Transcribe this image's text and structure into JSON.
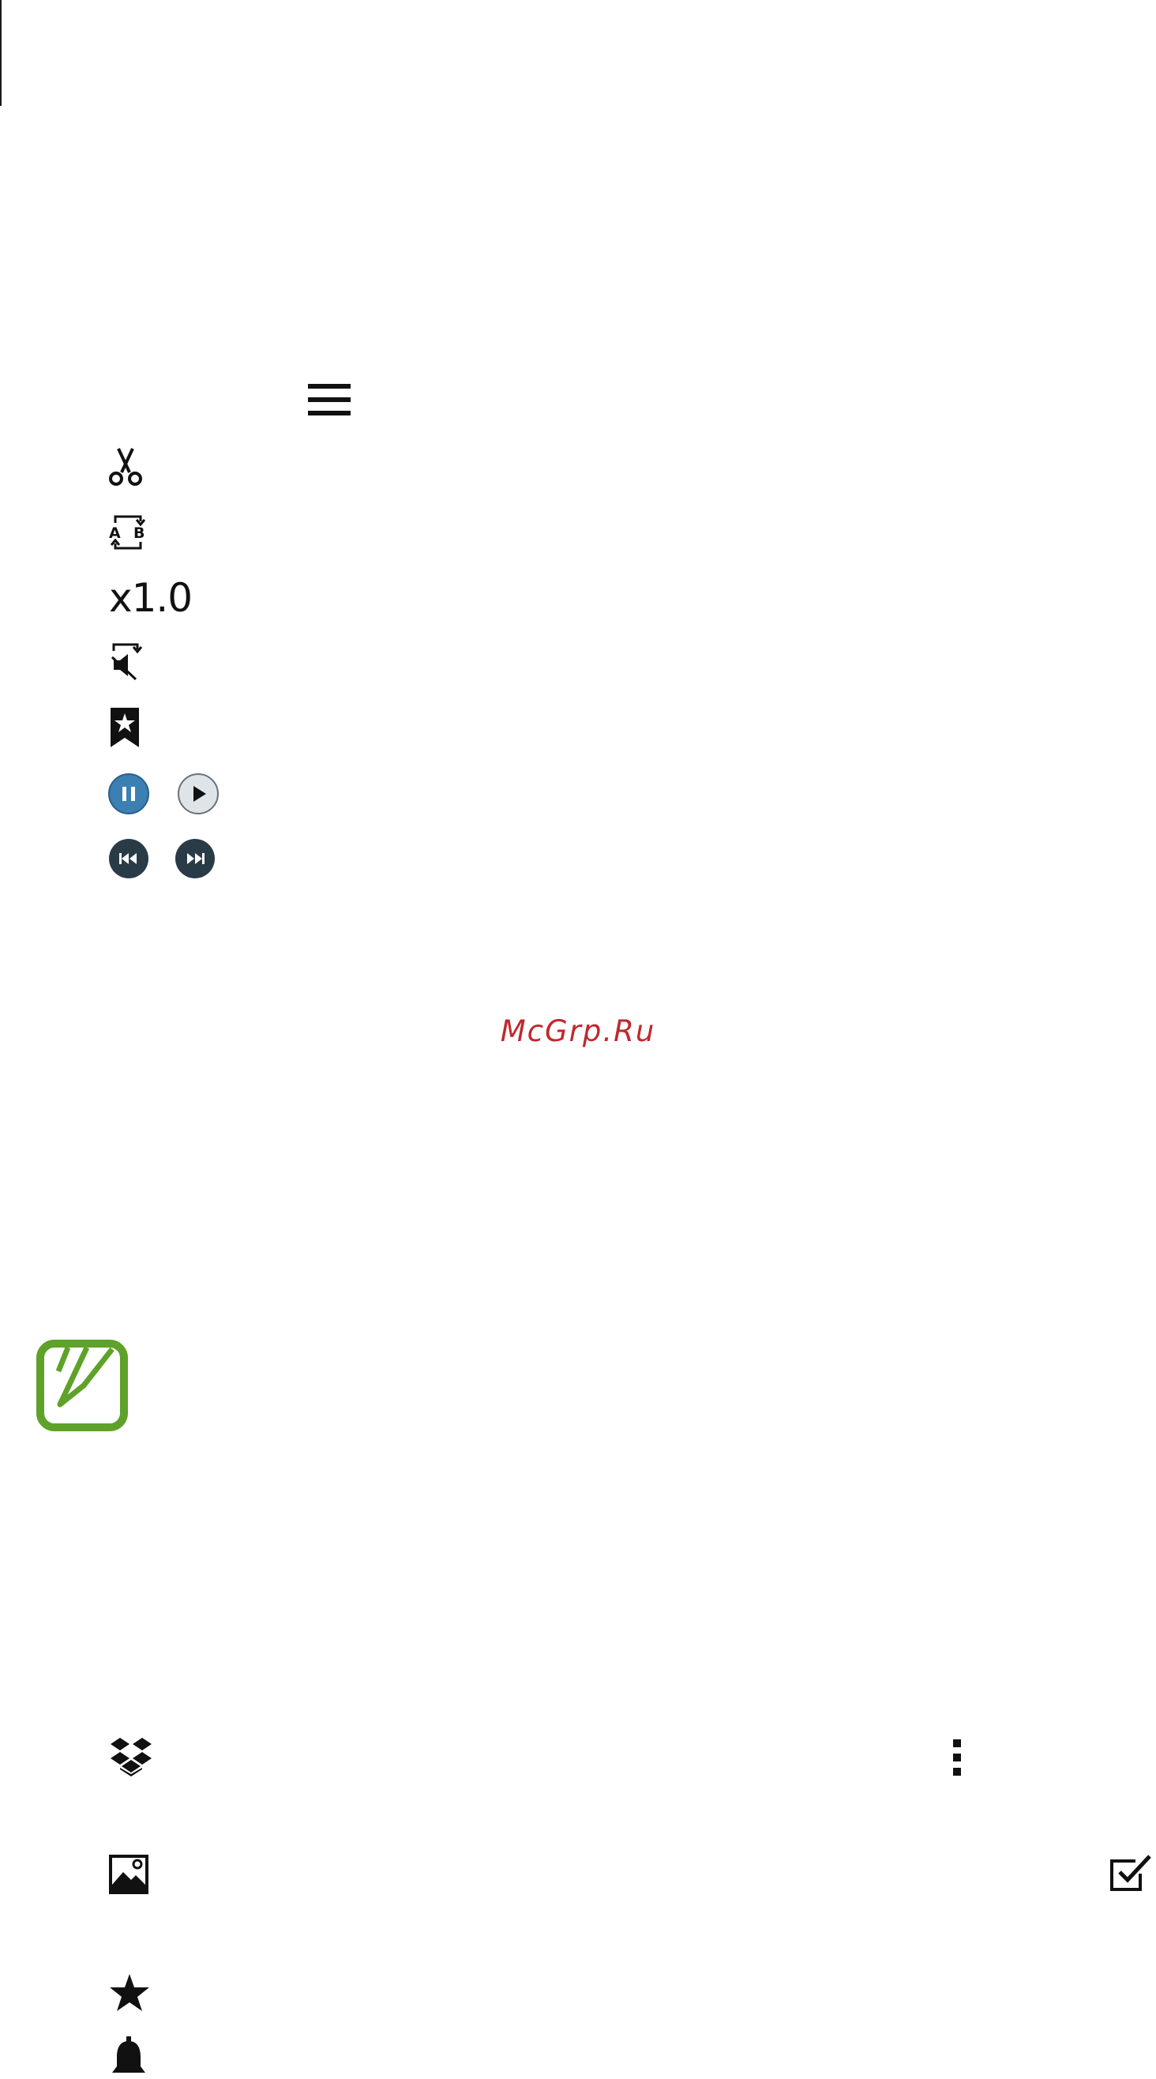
{
  "player_icons": {
    "menu": "menu-icon",
    "trim": "scissors-icon",
    "repeat_ab": "repeat-ab-icon",
    "speed_label": "x1.0",
    "mute_repeat": "mute-repeat-icon",
    "bookmark": "bookmark-star-icon",
    "pause": "pause-icon",
    "play": "play-icon",
    "rewind": "rewind-icon",
    "fast_forward": "fast-forward-icon",
    "pause_color": "#3b7fb3",
    "dark_button_color": "#2a3b48"
  },
  "watermark": {
    "text": "McGrp.Ru",
    "color": "#c0282d"
  },
  "note_icon": {
    "name": "note-pencil-icon",
    "color": "#5ea229"
  },
  "bottom_icons": {
    "dropbox": "dropbox-icon",
    "more": "more-options-icon",
    "gallery": "image-icon",
    "select": "checkbox-icon",
    "favorite": "star-icon",
    "notification": "bell-icon"
  }
}
